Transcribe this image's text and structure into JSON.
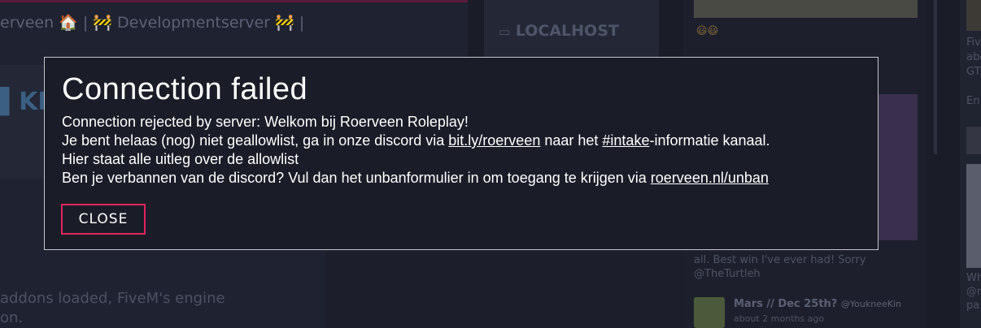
{
  "background": {
    "server_row": "erveen 🏠 | 🚧 Developmentserver 🚧 |",
    "kr_text": "▌KR",
    "localhost_label": "LOCALHOST",
    "addons_line1": "addons loaded, FiveM's engine",
    "addons_line2": "on.",
    "feed_text": "ying\nkes it\nall. Best win I've ever had! Sorry\n@TheTurtleh",
    "mars_title": "Mars // Dec 25th?",
    "mars_handle": "@YoukneeKin",
    "mars_time": "about 2 months ago",
    "far_text_top": "Fiv\nabc\nGT.\n\nEn",
    "far_text_bottom": "Wh\n@r\npa",
    "emoji": "😃😃"
  },
  "modal": {
    "title": "Connection failed",
    "line1": "Connection rejected by server: Welkom bij Roerveen Roleplay!",
    "line2_pre": "Je bent helaas (nog) niet geallowlist, ga in onze discord via ",
    "line2_link1": "bit.ly/roerveen",
    "line2_mid": " naar het ",
    "line2_link2": "#intake",
    "line2_post": "-informatie kanaal.",
    "line3": "Hier staat alle uitleg over de allowlist",
    "line4_pre": "Ben je verbannen van de discord? Vul dan het unbanformulier in om toegang te krijgen via ",
    "line4_link": "roerveen.nl/unban",
    "close_label": "CLOSE",
    "accent_color": "#e0245e"
  }
}
